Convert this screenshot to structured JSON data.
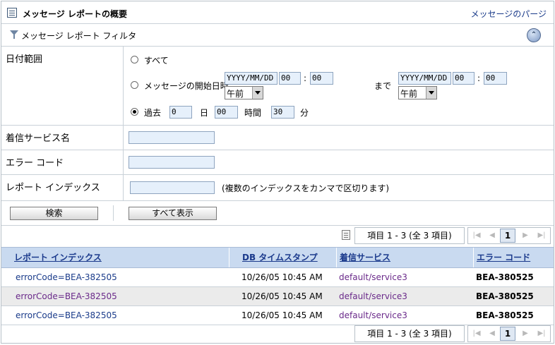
{
  "title": "メッセージ レポートの概要",
  "purge_link": "メッセージのパージ",
  "filter": {
    "header": "メッセージ レポート フィルタ",
    "collapse_symbol": "⌃",
    "date_range": {
      "label": "日付範囲",
      "all_label": "すべて",
      "start_label": "メッセージの開始日時",
      "start_date": "YYYY/MM/DD",
      "start_hour": "00",
      "start_min": "00",
      "start_ampm": "午前",
      "until_label": "まで",
      "end_date": "YYYY/MM/DD",
      "end_hour": "00",
      "end_min": "00",
      "end_ampm": "午前",
      "colon": ":",
      "past_label": "過去",
      "past_days": "0",
      "days_unit": "日",
      "past_hours": "00",
      "hours_unit": "時間",
      "past_minutes": "30",
      "minutes_unit": "分",
      "selected": "past"
    },
    "inbound_service": {
      "label": "着信サービス名",
      "value": ""
    },
    "error_code": {
      "label": "エラー コード",
      "value": ""
    },
    "report_index": {
      "label": "レポート インデックス",
      "value": "",
      "hint": "(複数のインデックスをカンマで区切ります)"
    },
    "search_button": "検索",
    "show_all_button": "すべて表示"
  },
  "pager": {
    "info": "項目 1 - 3 (全 3 項目)",
    "current_page": "1",
    "first": "|◀",
    "prev": "◀",
    "next": "▶",
    "last": "▶|"
  },
  "table": {
    "columns": [
      "レポート インデックス",
      "DB タイムスタンプ",
      "着信サービス",
      "エラー コード"
    ],
    "rows": [
      {
        "index": "errorCode=BEA-382505",
        "timestamp": "10/26/05 10:45 AM",
        "service": "default/service3",
        "error_code": "BEA-380525"
      },
      {
        "index": "errorCode=BEA-382505",
        "timestamp": "10/26/05 10:45 AM",
        "service": "default/service3",
        "error_code": "BEA-380525"
      },
      {
        "index": "errorCode=BEA-382505",
        "timestamp": "10/26/05 10:45 AM",
        "service": "default/service3",
        "error_code": "BEA-380525"
      }
    ]
  }
}
